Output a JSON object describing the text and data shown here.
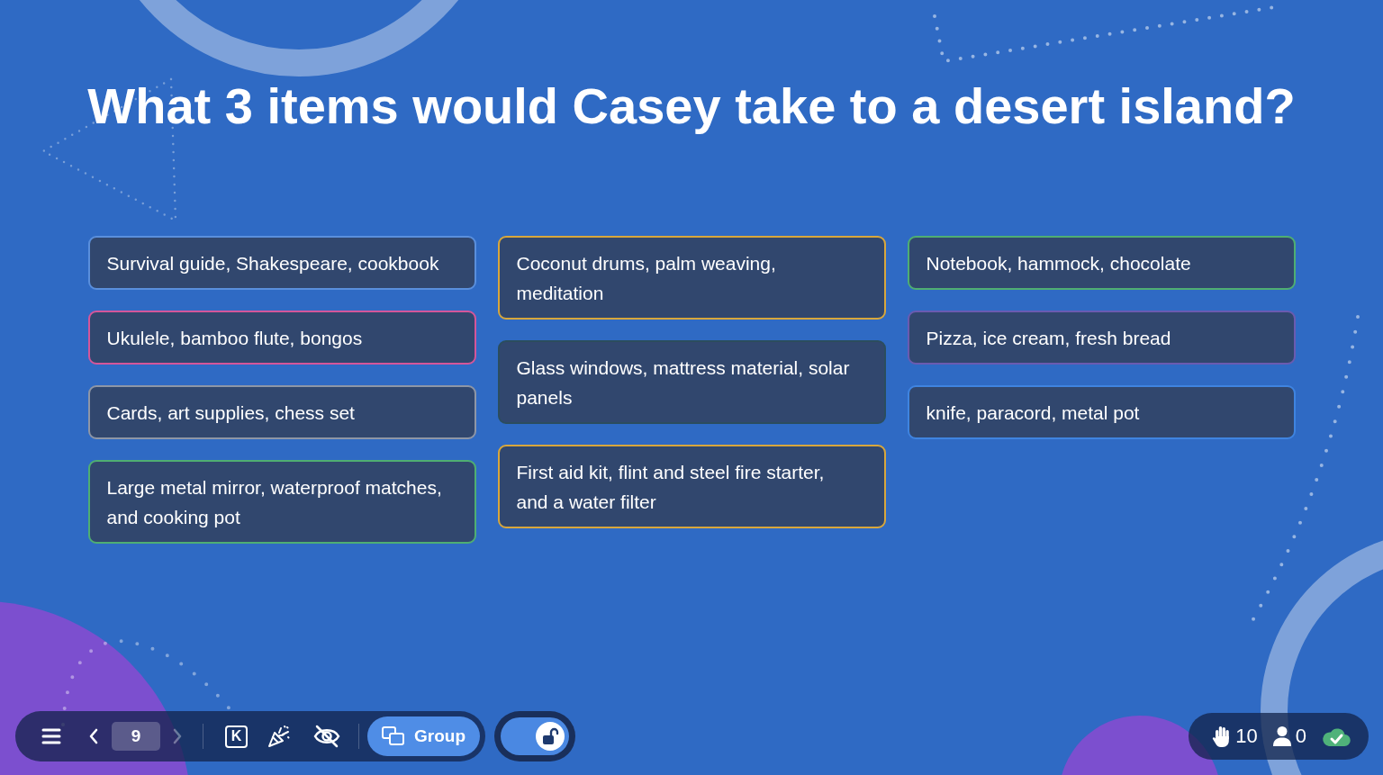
{
  "title": "What 3 items would Casey take to a desert island?",
  "columns": [
    {
      "cards": [
        {
          "text": "Survival guide, Shakespeare, cookbook",
          "color": "#5a8fdc"
        },
        {
          "text": "Ukulele, bamboo flute, bongos",
          "color": "#d4569a"
        },
        {
          "text": "Cards, art supplies, chess set",
          "color": "#8e96a6"
        },
        {
          "text": "Large metal mirror, waterproof matches, and cooking pot",
          "color": "#4fae72"
        }
      ]
    },
    {
      "cards": [
        {
          "text": "Coconut drums, palm weaving, meditation",
          "color": "#d8a73c"
        },
        {
          "text": "Glass windows, mattress material, solar panels",
          "color": "#2b4d5e"
        },
        {
          "text": "First aid kit, flint and steel fire starter, and a water filter",
          "color": "#d8a73c"
        }
      ]
    },
    {
      "cards": [
        {
          "text": "Notebook, hammock, chocolate",
          "color": "#4fae72"
        },
        {
          "text": "Pizza, ice cream, fresh bread",
          "color": "#6a5bb0"
        },
        {
          "text": "knife, paracord, metal pot",
          "color": "#3f84e0"
        }
      ]
    }
  ],
  "toolbar": {
    "previous": {
      "disabled": false
    },
    "page": "9",
    "next": {
      "disabled": true
    },
    "shortcut_key": "K",
    "group_button": "Group"
  },
  "lock_toggle": {
    "on": true
  },
  "status": {
    "raised_hands": "10",
    "participants": "0"
  }
}
